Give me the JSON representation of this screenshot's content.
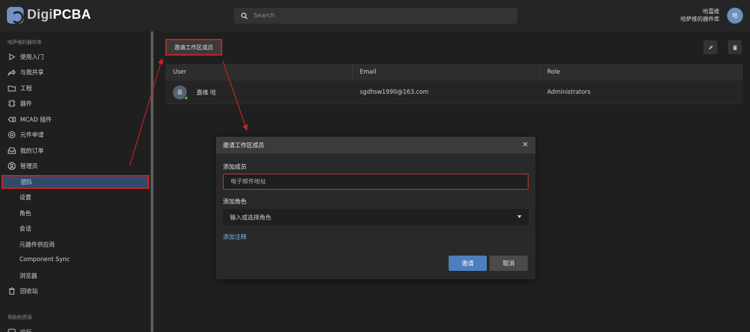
{
  "app": {
    "logo_prefix": "Digi",
    "logo_suffix": "PCBA"
  },
  "search": {
    "placeholder": "Search"
  },
  "user": {
    "name": "哈嘉维",
    "library": "哈萨维的器件库",
    "avatar_text": "哈"
  },
  "sidebar": {
    "section1_title": "哈萨维的器件库",
    "items": [
      {
        "label": "使用入门",
        "icon": "play-triangle-icon"
      },
      {
        "label": "与我共享",
        "icon": "share-icon"
      },
      {
        "label": "工程",
        "icon": "folder-icon"
      },
      {
        "label": "器件",
        "icon": "chip-icon"
      },
      {
        "label": "MCAD 插件",
        "icon": "plugin-icon"
      },
      {
        "label": "元件申请",
        "icon": "gear-request-icon"
      },
      {
        "label": "我的订单",
        "icon": "inbox-icon"
      },
      {
        "label": "管理员",
        "icon": "user-icon"
      }
    ],
    "admin_subitems": [
      "团队",
      "设置",
      "角色",
      "会话",
      "元器件供应商",
      "Component Sync",
      "浏览器"
    ],
    "recycle": {
      "label": "回收站",
      "icon": "trash-icon"
    },
    "section2_title": "帮助和资源",
    "partial_item": "论坛"
  },
  "main": {
    "invite_button": "邀请工作区成员",
    "table": {
      "headers": [
        "User",
        "Email",
        "Role"
      ],
      "rows": [
        {
          "avatar": "嘉",
          "user": "嘉维 哈",
          "email": "sgdhsw1990@163.com",
          "role": "Administrators"
        }
      ]
    }
  },
  "dialog": {
    "title": "邀请工作区成员",
    "close": "×",
    "member_label": "添加成员",
    "email_placeholder": "电子邮件地址",
    "role_label": "添加角色",
    "role_placeholder": "输入或选择角色",
    "add_note": "添加注释",
    "invite_button": "邀请",
    "cancel_button": "取消"
  },
  "colors": {
    "accent": "#4d7fc0",
    "highlight": "#c42424",
    "link": "#7db3ea",
    "active_bg": "#2f4a6a"
  }
}
